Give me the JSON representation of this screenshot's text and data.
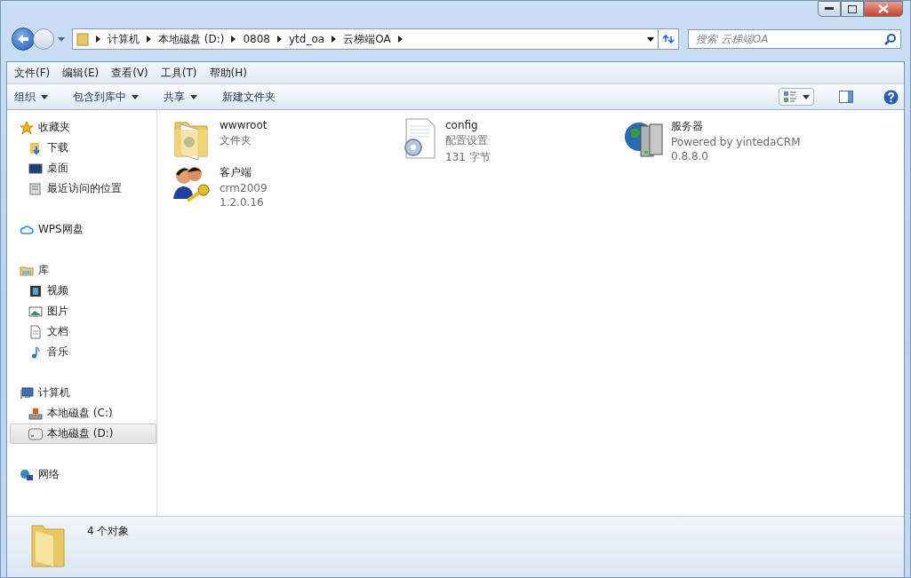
{
  "breadcrumb": [
    "计算机",
    "本地磁盘 (D:)",
    "0808",
    "ytd_oa",
    "云梯端OA"
  ],
  "search": {
    "placeholder": "搜索 云梯端OA"
  },
  "menu": [
    "文件(F)",
    "编辑(E)",
    "查看(V)",
    "工具(T)",
    "帮助(H)"
  ],
  "toolbar": [
    {
      "label": "组织",
      "dropdown": true
    },
    {
      "label": "包含到库中",
      "dropdown": true
    },
    {
      "label": "共享",
      "dropdown": true
    },
    {
      "label": "新建文件夹",
      "dropdown": false
    }
  ],
  "sidebar": [
    {
      "label": "收藏夹",
      "children": [
        {
          "label": "下载",
          "selected": false
        },
        {
          "label": "桌面",
          "selected": false
        },
        {
          "label": "最近访问的位置",
          "selected": false
        }
      ]
    },
    {
      "label": "WPS网盘"
    },
    {
      "label": "库",
      "children": [
        {
          "label": "视频",
          "selected": false
        },
        {
          "label": "图片",
          "selected": false
        },
        {
          "label": "文档",
          "selected": false
        },
        {
          "label": "音乐",
          "selected": false
        }
      ]
    },
    {
      "label": "计算机",
      "children": [
        {
          "label": "本地磁盘 (C:)",
          "selected": false
        },
        {
          "label": "本地磁盘 (D:)",
          "selected": true
        }
      ]
    },
    {
      "label": "网络"
    }
  ],
  "items": [
    {
      "name": "wwwroot",
      "lines": [
        "文件夹"
      ]
    },
    {
      "name": "config",
      "lines": [
        "配置设置",
        "131 字节"
      ]
    },
    {
      "name": "服务器",
      "lines": [
        "Powered by yintedaCRM",
        "0.8.8.0"
      ]
    },
    {
      "name": "客户端",
      "lines": [
        "crm2009",
        "1.2.0.16"
      ]
    }
  ],
  "status": "4 个对象"
}
